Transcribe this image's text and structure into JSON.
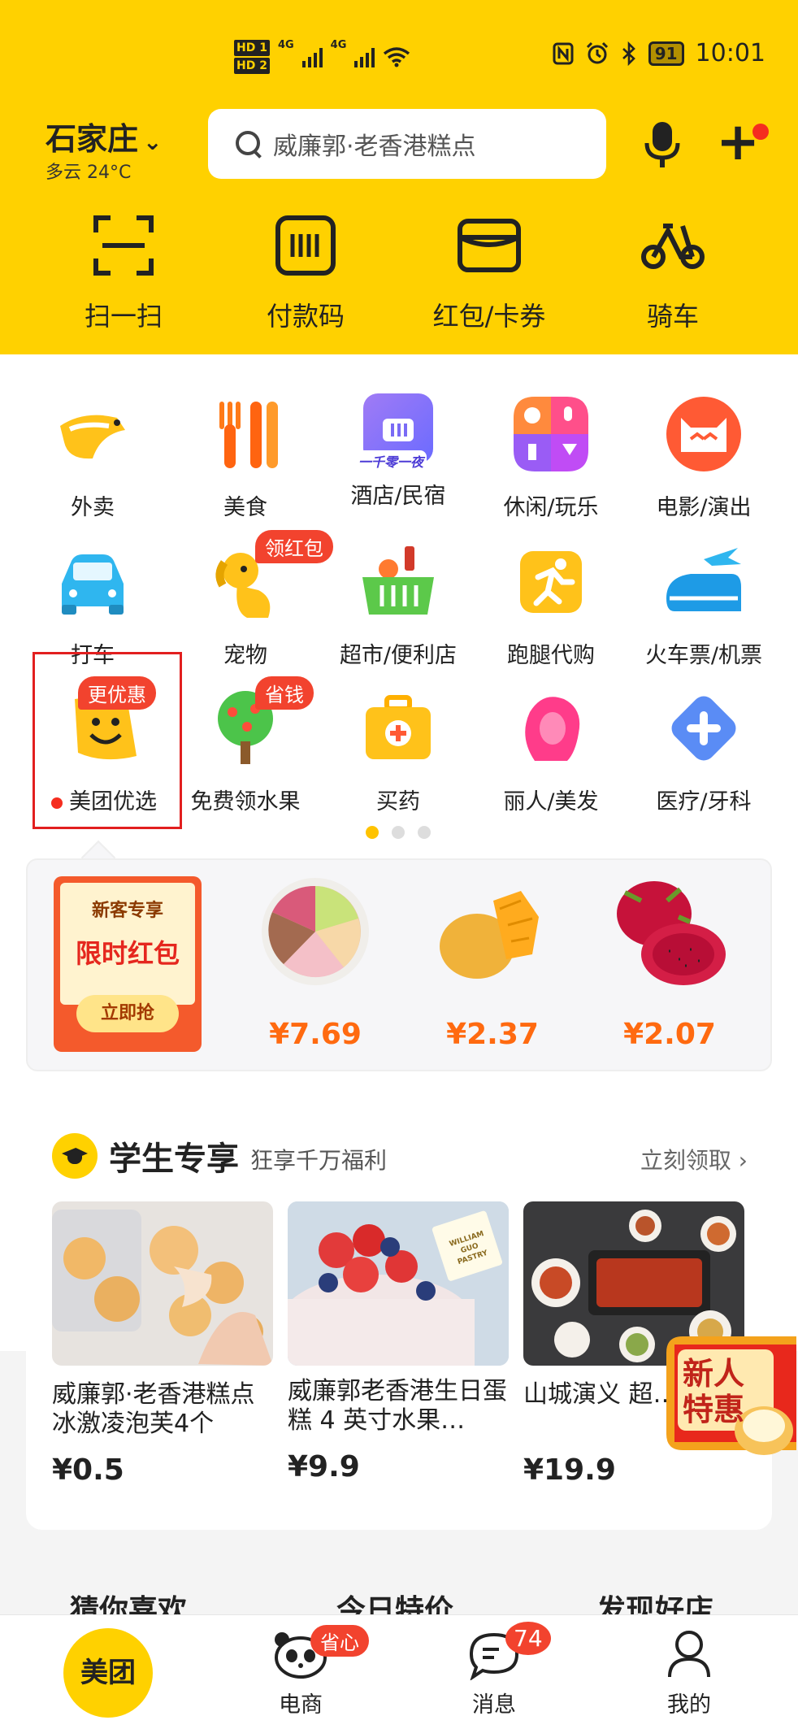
{
  "status_bar": {
    "hd1": "HD 1",
    "hd2": "HD 2",
    "net1": "4G",
    "net2": "4G",
    "battery": "91",
    "time": "10:01"
  },
  "header": {
    "city": "石家庄",
    "weather": "多云 24°C",
    "search_placeholder": "威廉郭·老香港糕点",
    "quick_actions": [
      {
        "label": "扫一扫",
        "icon": "scan-icon"
      },
      {
        "label": "付款码",
        "icon": "payment-code-icon"
      },
      {
        "label": "红包/卡券",
        "icon": "wallet-icon"
      },
      {
        "label": "骑车",
        "icon": "bike-icon"
      }
    ]
  },
  "grid": [
    {
      "label": "外卖",
      "icon": "kangaroo-icon"
    },
    {
      "label": "美食",
      "icon": "fork-knife-icon"
    },
    {
      "label": "酒店/民宿",
      "icon": "hotel-icon",
      "icon_text": "一千零一夜"
    },
    {
      "label": "休闲/玩乐",
      "icon": "leisure-icon"
    },
    {
      "label": "电影/演出",
      "icon": "cat-icon"
    },
    {
      "label": "打车",
      "icon": "car-icon"
    },
    {
      "label": "宠物",
      "icon": "dog-icon",
      "badge": "领红包"
    },
    {
      "label": "超市/便利店",
      "icon": "basket-icon"
    },
    {
      "label": "跑腿代购",
      "icon": "runner-icon"
    },
    {
      "label": "火车票/机票",
      "icon": "plane-icon"
    },
    {
      "label": "美团优选",
      "icon": "smile-icon",
      "badge": "更优惠"
    },
    {
      "label": "免费领水果",
      "icon": "tree-icon",
      "badge": "省钱"
    },
    {
      "label": "买药",
      "icon": "medicine-box-icon"
    },
    {
      "label": "丽人/美发",
      "icon": "beauty-icon"
    },
    {
      "label": "医疗/牙科",
      "icon": "medical-cross-icon"
    }
  ],
  "promo": {
    "newbie_title": "新客专享",
    "newbie_main": "限时红包",
    "newbie_button": "立即抢",
    "products": [
      {
        "price": "¥7.69",
        "icon": "cake-icon"
      },
      {
        "price": "¥2.37",
        "icon": "mango-icon"
      },
      {
        "price": "¥2.07",
        "icon": "dragon-fruit-icon"
      }
    ]
  },
  "student": {
    "title": "学生专享",
    "subtitle": "狂享千万福利",
    "more": "立刻领取",
    "items": [
      {
        "name": "威廉郭·老香港糕点冰激凌泡芙4个",
        "price": "¥0.5"
      },
      {
        "name": "威廉郭老香港生日蛋糕 4 英寸水果…",
        "price": "¥9.9",
        "img_text": "WILLIAM GUO PASTRY"
      },
      {
        "name": "山城演义 超…餐",
        "price": "¥19.9"
      }
    ]
  },
  "float_promo": "新人特惠",
  "section_tabs": [
    "猜你喜欢",
    "今日特价",
    "发现好店"
  ],
  "bottom_nav": [
    {
      "label": "美团"
    },
    {
      "label": "电商",
      "badge": "省心"
    },
    {
      "label": "消息",
      "badge": "74"
    },
    {
      "label": "我的"
    }
  ],
  "colors": {
    "brand_yellow": "#FFD100",
    "badge_red": "#F2432E",
    "price_orange": "#FF6A10"
  }
}
